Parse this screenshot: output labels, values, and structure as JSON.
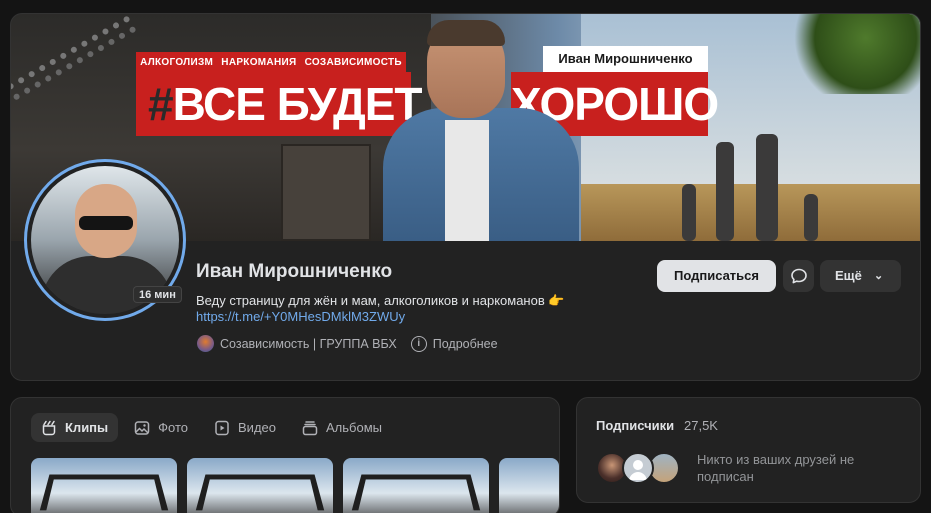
{
  "cover": {
    "tags": [
      "АЛКОГОЛИЗМ",
      "НАРКОМАНИЯ",
      "СОЗАВИСИМОСТЬ"
    ],
    "hash": "#",
    "headline_left": "ВСЕ БУДЕТ",
    "headline_right": "ХОРОШО",
    "name_label": "Иван Мирошниченко"
  },
  "profile": {
    "name": "Иван Мирошниченко",
    "story_badge": "16 мин",
    "status": "Веду страницу для жён и мам, алкоголиков и наркоманов",
    "status_emoji": "👉",
    "link": "https://t.me/+Y0MHesDMklM3ZWUy",
    "group": "Созависимость | ГРУППА ВБХ",
    "more_info": "Подробнее",
    "info_glyph": "i"
  },
  "actions": {
    "subscribe": "Подписаться",
    "more": "Ещё",
    "chevron": "⌄"
  },
  "media": {
    "tabs": [
      {
        "label": "Клипы",
        "icon": "clips-icon",
        "active": true
      },
      {
        "label": "Фото",
        "icon": "photo-icon",
        "active": false
      },
      {
        "label": "Видео",
        "icon": "video-icon",
        "active": false
      },
      {
        "label": "Альбомы",
        "icon": "albums-icon",
        "active": false
      }
    ]
  },
  "subscribers": {
    "title": "Подписчики",
    "count": "27,5K",
    "note": "Никто из ваших друзей не подписан"
  },
  "colors": {
    "accent": "#71aaeb",
    "banner_red": "#c8201e",
    "card_bg": "#222222",
    "page_bg": "#141414"
  }
}
